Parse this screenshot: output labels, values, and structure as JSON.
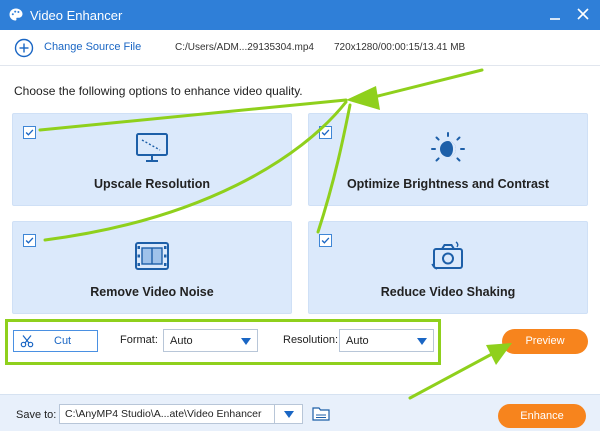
{
  "window": {
    "title": "Video Enhancer"
  },
  "source": {
    "change_label": "Change Source File",
    "file_path": "C:/Users/ADM...29135304.mp4",
    "file_info": "720x1280/00:00:15/13.41 MB"
  },
  "instruction": "Choose the following options to enhance video quality.",
  "options": [
    {
      "label": "Upscale Resolution",
      "checked": true,
      "icon": "monitor-resolution-icon"
    },
    {
      "label": "Optimize Brightness and Contrast",
      "checked": true,
      "icon": "brightness-icon"
    },
    {
      "label": "Remove Video Noise",
      "checked": true,
      "icon": "film-noise-icon"
    },
    {
      "label": "Reduce Video Shaking",
      "checked": true,
      "icon": "camera-shake-icon"
    }
  ],
  "controls": {
    "cut_label": "Cut",
    "format_label": "Format:",
    "format_value": "Auto",
    "resolution_label": "Resolution:",
    "resolution_value": "Auto",
    "preview_label": "Preview"
  },
  "footer": {
    "save_to_label": "Save to:",
    "save_path": "C:\\AnyMP4 Studio\\A...ate\\Video Enhancer",
    "enhance_label": "Enhance"
  },
  "colors": {
    "titlebar": "#2f7fd8",
    "card_bg": "#dbe9fb",
    "accent_blue": "#1a66c4",
    "button_orange": "#f7841d",
    "highlight_green": "#8fd01c"
  }
}
